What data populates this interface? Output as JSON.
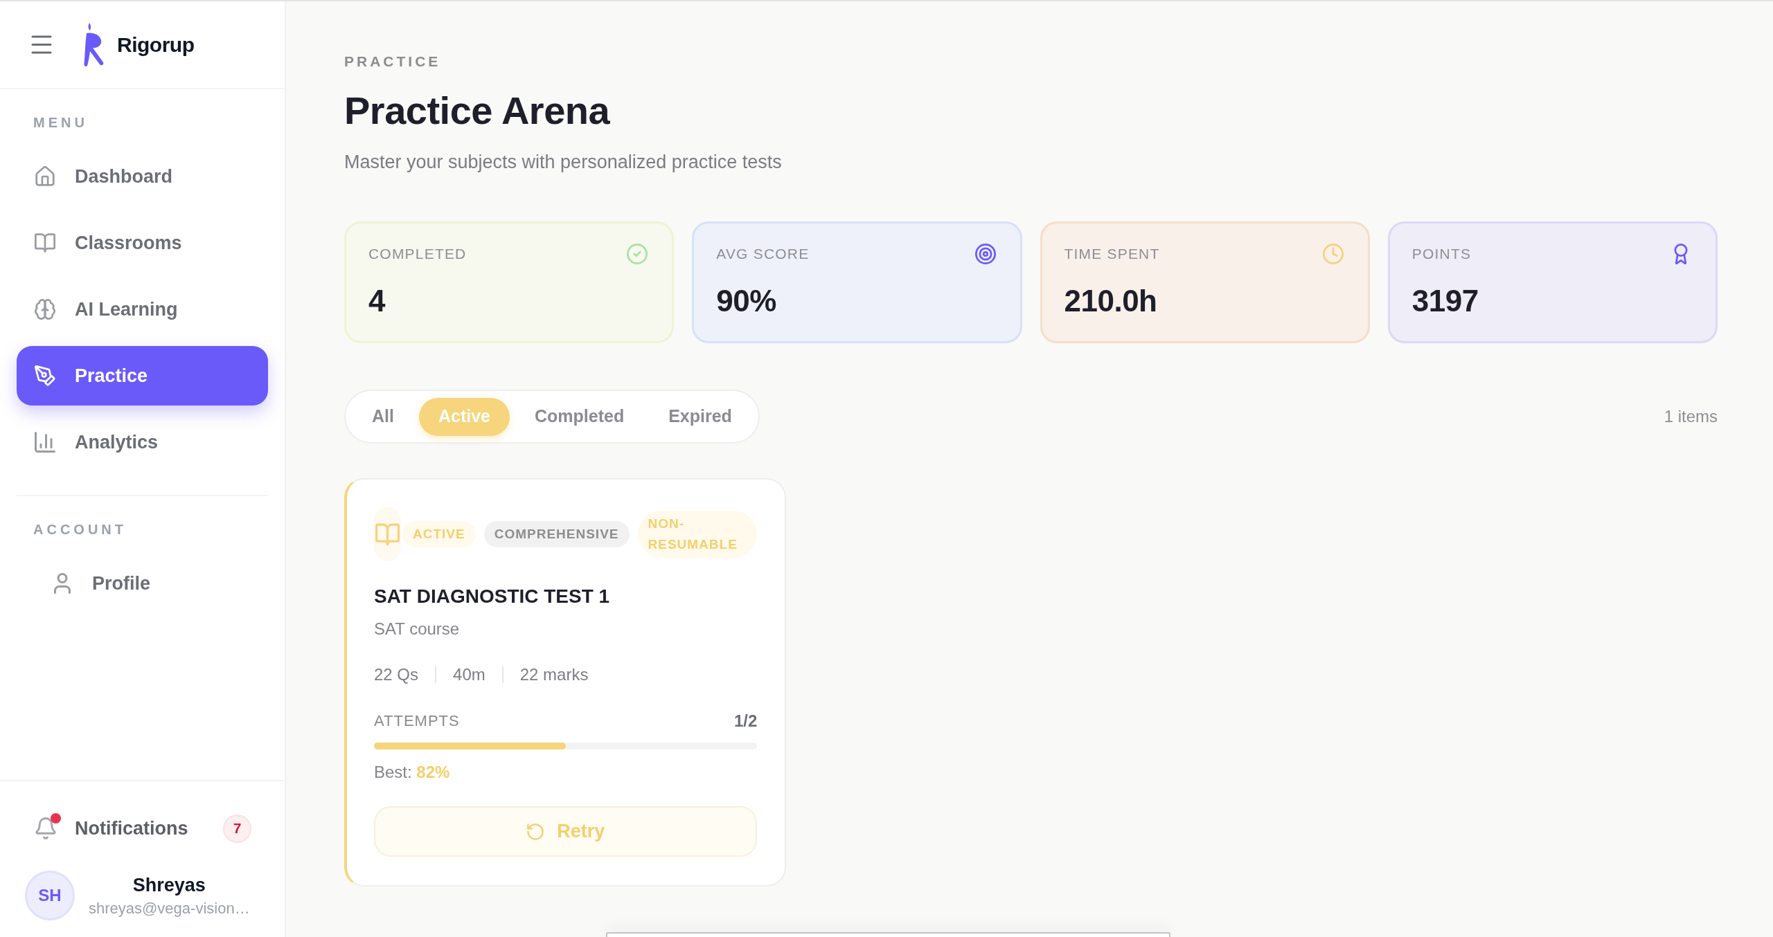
{
  "sidebar": {
    "brand": "Rigorup",
    "sections": [
      {
        "title": "MENU",
        "items": [
          {
            "label": "Dashboard",
            "selected": false
          },
          {
            "label": "Classrooms",
            "selected": false
          },
          {
            "label": "AI Learning",
            "selected": false
          },
          {
            "label": "Practice",
            "selected": true
          },
          {
            "label": "Analytics",
            "selected": false
          }
        ]
      },
      {
        "title": "ACCOUNT",
        "items": [
          {
            "label": "Profile",
            "selected": false
          }
        ]
      }
    ],
    "notifications": {
      "label": "Notifications",
      "count": "7",
      "unread": true
    },
    "user": {
      "initials": "SH",
      "name": "Shreyas",
      "email": "shreyas@vega-vision…"
    }
  },
  "header": {
    "eyebrow": "PRACTICE",
    "title": "Practice Arena",
    "subtitle": "Master your subjects with personalized practice tests"
  },
  "stats": [
    {
      "label": "COMPLETED",
      "value": "4",
      "color": "#a6e3a1"
    },
    {
      "label": "AVG SCORE",
      "value": "90%",
      "color": "#6a5af9"
    },
    {
      "label": "TIME SPENT",
      "value": "210.0h",
      "color": "#f6d27a"
    },
    {
      "label": "POINTS",
      "value": "3197",
      "color": "#6a5af9"
    }
  ],
  "filters": {
    "tabs": [
      {
        "label": "All",
        "selected": false
      },
      {
        "label": "Active",
        "selected": true
      },
      {
        "label": "Completed",
        "selected": false
      },
      {
        "label": "Expired",
        "selected": false
      }
    ],
    "count": "1 items"
  },
  "tests": [
    {
      "tags": [
        {
          "label": "ACTIVE",
          "kind": "accent"
        },
        {
          "label": "COMPREHENSIVE",
          "kind": "neutral"
        },
        {
          "label": "NON-RESUMABLE",
          "kind": "accent"
        }
      ],
      "title": "SAT DIAGNOSTIC TEST 1",
      "course": "SAT course",
      "meta": [
        "22 Qs",
        "40m",
        "22 marks"
      ],
      "attempts_label": "ATTEMPTS",
      "attempts": "1/2",
      "level": 0.5,
      "best": "Best: **82%**",
      "action": "Retry"
    }
  ]
}
